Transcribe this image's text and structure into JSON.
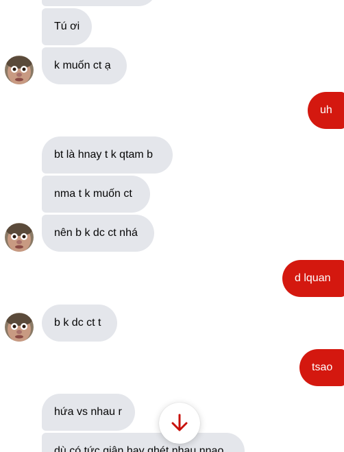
{
  "colors": {
    "incoming_bubble": "#e4e6eb",
    "outgoing_bubble": "#d4180f",
    "accent": "#c8120c"
  },
  "messages": [
    {
      "text": "",
      "direction": "incoming"
    },
    {
      "text": "Tú ơi",
      "direction": "incoming"
    },
    {
      "text": "k muốn ct ạ",
      "direction": "incoming"
    },
    {
      "text": "uh",
      "direction": "outgoing"
    },
    {
      "text": "bt là hnay t k qtam b",
      "direction": "incoming"
    },
    {
      "text": "nma t k muốn ct",
      "direction": "incoming"
    },
    {
      "text": "nên b k dc ct nhá",
      "direction": "incoming"
    },
    {
      "text": "d lquan",
      "direction": "outgoing"
    },
    {
      "text": "b k dc ct t",
      "direction": "incoming"
    },
    {
      "text": "tsao",
      "direction": "outgoing"
    },
    {
      "text": "hứa vs nhau r",
      "direction": "incoming"
    },
    {
      "text": "dù có tức giận hay ghét nhau nnao",
      "direction": "incoming"
    }
  ],
  "scroll_button": {
    "icon": "arrow-down-icon"
  },
  "avatar": {
    "icon": "contact-avatar"
  }
}
